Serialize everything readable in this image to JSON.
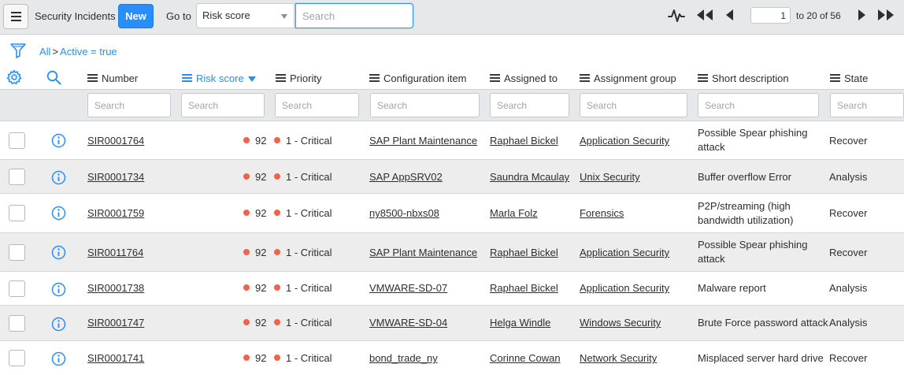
{
  "toolbar": {
    "list_title": "Security Incidents",
    "new_label": "New",
    "goto_label": "Go to",
    "goto_field": "Risk score",
    "search_placeholder": "Search",
    "page_value": "1",
    "page_range": "to 20 of 56"
  },
  "breadcrumb": {
    "all": "All",
    "separator": ">",
    "condition": "Active = true"
  },
  "columns": [
    {
      "label": "Number"
    },
    {
      "label": "Risk score",
      "sorted": "desc"
    },
    {
      "label": "Priority"
    },
    {
      "label": "Configuration item"
    },
    {
      "label": "Assigned to"
    },
    {
      "label": "Assignment group"
    },
    {
      "label": "Short description"
    },
    {
      "label": "State"
    }
  ],
  "column_search_placeholder": "Search",
  "rows": [
    {
      "number": "SIR0001764",
      "risk": "92",
      "priority": "1 - Critical",
      "ci": "SAP Plant Maintenance",
      "assigned": "Raphael Bickel",
      "group": "Application Security",
      "desc": "Possible Spear phishing attack",
      "state": "Recover"
    },
    {
      "number": "SIR0001734",
      "risk": "92",
      "priority": "1 - Critical",
      "ci": "SAP AppSRV02",
      "assigned": "Saundra Mcaulay",
      "group": "Unix Security",
      "desc": "Buffer overflow Error",
      "state": "Analysis"
    },
    {
      "number": "SIR0001759",
      "risk": "92",
      "priority": "1 - Critical",
      "ci": "ny8500-nbxs08",
      "assigned": "Marla Folz",
      "group": "Forensics",
      "desc": "P2P/streaming (high bandwidth utilization)",
      "state": "Recover"
    },
    {
      "number": "SIR0011764",
      "risk": "92",
      "priority": "1 - Critical",
      "ci": "SAP Plant Maintenance",
      "assigned": "Raphael Bickel",
      "group": "Application Security",
      "desc": "Possible Spear phishing attack",
      "state": "Recover"
    },
    {
      "number": "SIR0001738",
      "risk": "92",
      "priority": "1 - Critical",
      "ci": "VMWARE-SD-07",
      "assigned": "Raphael Bickel",
      "group": "Application Security",
      "desc": "Malware report",
      "state": "Analysis"
    },
    {
      "number": "SIR0001747",
      "risk": "92",
      "priority": "1 - Critical",
      "ci": "VMWARE-SD-04",
      "assigned": "Helga Windle",
      "group": "Windows Security",
      "desc": "Brute Force password attack",
      "state": "Analysis"
    },
    {
      "number": "SIR0001741",
      "risk": "92",
      "priority": "1 - Critical",
      "ci": "bond_trade_ny",
      "assigned": "Corinne Cowan",
      "group": "Network Security",
      "desc": "Misplaced server hard drive",
      "state": "Recover"
    }
  ],
  "colors": {
    "accent": "#278efc",
    "critical_dot": "#f0644c",
    "toolbar_bg": "#e6e8ea",
    "alt_row_bg": "#ededed"
  },
  "icons": {
    "menu": "hamburger-icon",
    "activity": "activity-stream-icon",
    "first": "first-page-icon",
    "prev": "previous-page-icon",
    "next": "next-page-icon",
    "last": "last-page-icon",
    "filter": "filter-funnel-icon",
    "settings": "gear-icon",
    "search": "search-icon",
    "info": "info-circle-icon"
  }
}
